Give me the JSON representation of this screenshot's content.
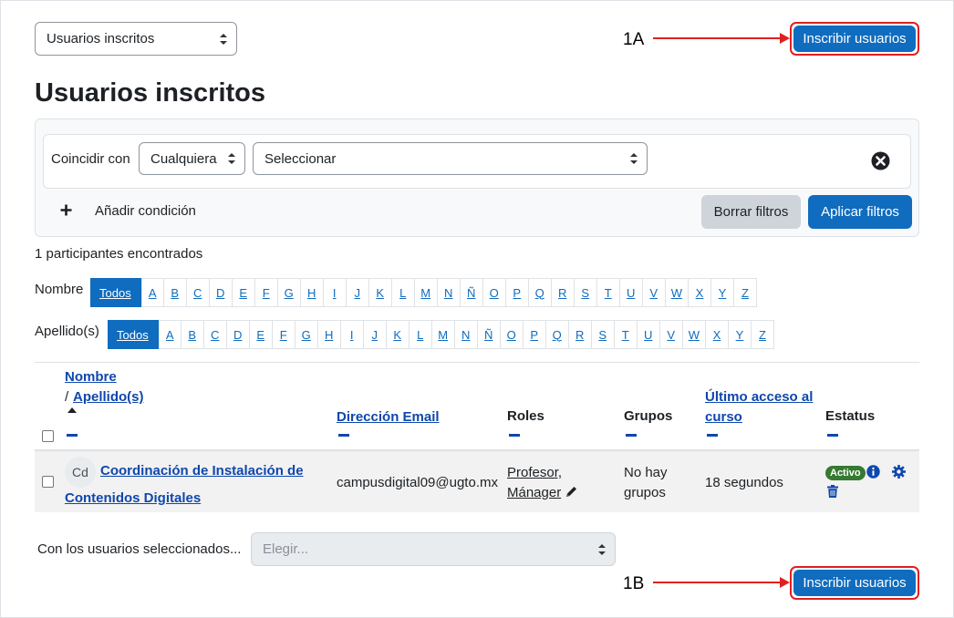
{
  "top_select": {
    "value": "Usuarios inscritos"
  },
  "enrol_button_top": {
    "label": "Inscribir usuarios",
    "annotation": "1A"
  },
  "enrol_button_bottom": {
    "label": "Inscribir usuarios",
    "annotation": "1B"
  },
  "page_title": "Usuarios inscritos",
  "filters": {
    "match_label": "Coincidir con",
    "match_select": "Cualquiera",
    "condition_select": "Seleccionar",
    "add_condition": "Añadir condición",
    "clear_button": "Borrar filtros",
    "apply_button": "Aplicar filtros"
  },
  "participants_count": "1 participantes encontrados",
  "first_name_filter": {
    "label": "Nombre",
    "all": "Todos",
    "letters": [
      "A",
      "B",
      "C",
      "D",
      "E",
      "F",
      "G",
      "H",
      "I",
      "J",
      "K",
      "L",
      "M",
      "N",
      "Ñ",
      "O",
      "P",
      "Q",
      "R",
      "S",
      "T",
      "U",
      "V",
      "W",
      "X",
      "Y",
      "Z"
    ]
  },
  "last_name_filter": {
    "label": "Apellido(s)",
    "all": "Todos",
    "letters": [
      "A",
      "B",
      "C",
      "D",
      "E",
      "F",
      "G",
      "H",
      "I",
      "J",
      "K",
      "L",
      "M",
      "N",
      "Ñ",
      "O",
      "P",
      "Q",
      "R",
      "S",
      "T",
      "U",
      "V",
      "W",
      "X",
      "Y",
      "Z"
    ]
  },
  "table": {
    "headers": {
      "first_name": "Nombre",
      "separator": "/",
      "last_name": "Apellido(s)",
      "email": "Dirección Email",
      "roles": "Roles",
      "groups": "Grupos",
      "last_access_1": "Último acceso al",
      "last_access_2": "curso",
      "status": "Estatus"
    },
    "rows": [
      {
        "initials": "Cd",
        "name_1": "Coordinación de Instalación de",
        "name_2": "Contenidos Digitales",
        "email": "campusdigital09@ugto.mx",
        "role_1": "Profesor,",
        "role_2": "Mánager",
        "groups_1": "No hay",
        "groups_2": "grupos",
        "last_access": "18 segundos",
        "status": "Activo"
      }
    ]
  },
  "bulk_action": {
    "label": "Con los usuarios seleccionados...",
    "placeholder": "Elegir..."
  },
  "colors": {
    "primary": "#0f6cbf",
    "link": "#0f47ad",
    "annotation_red": "#e0201f",
    "active_badge": "#357a32"
  }
}
